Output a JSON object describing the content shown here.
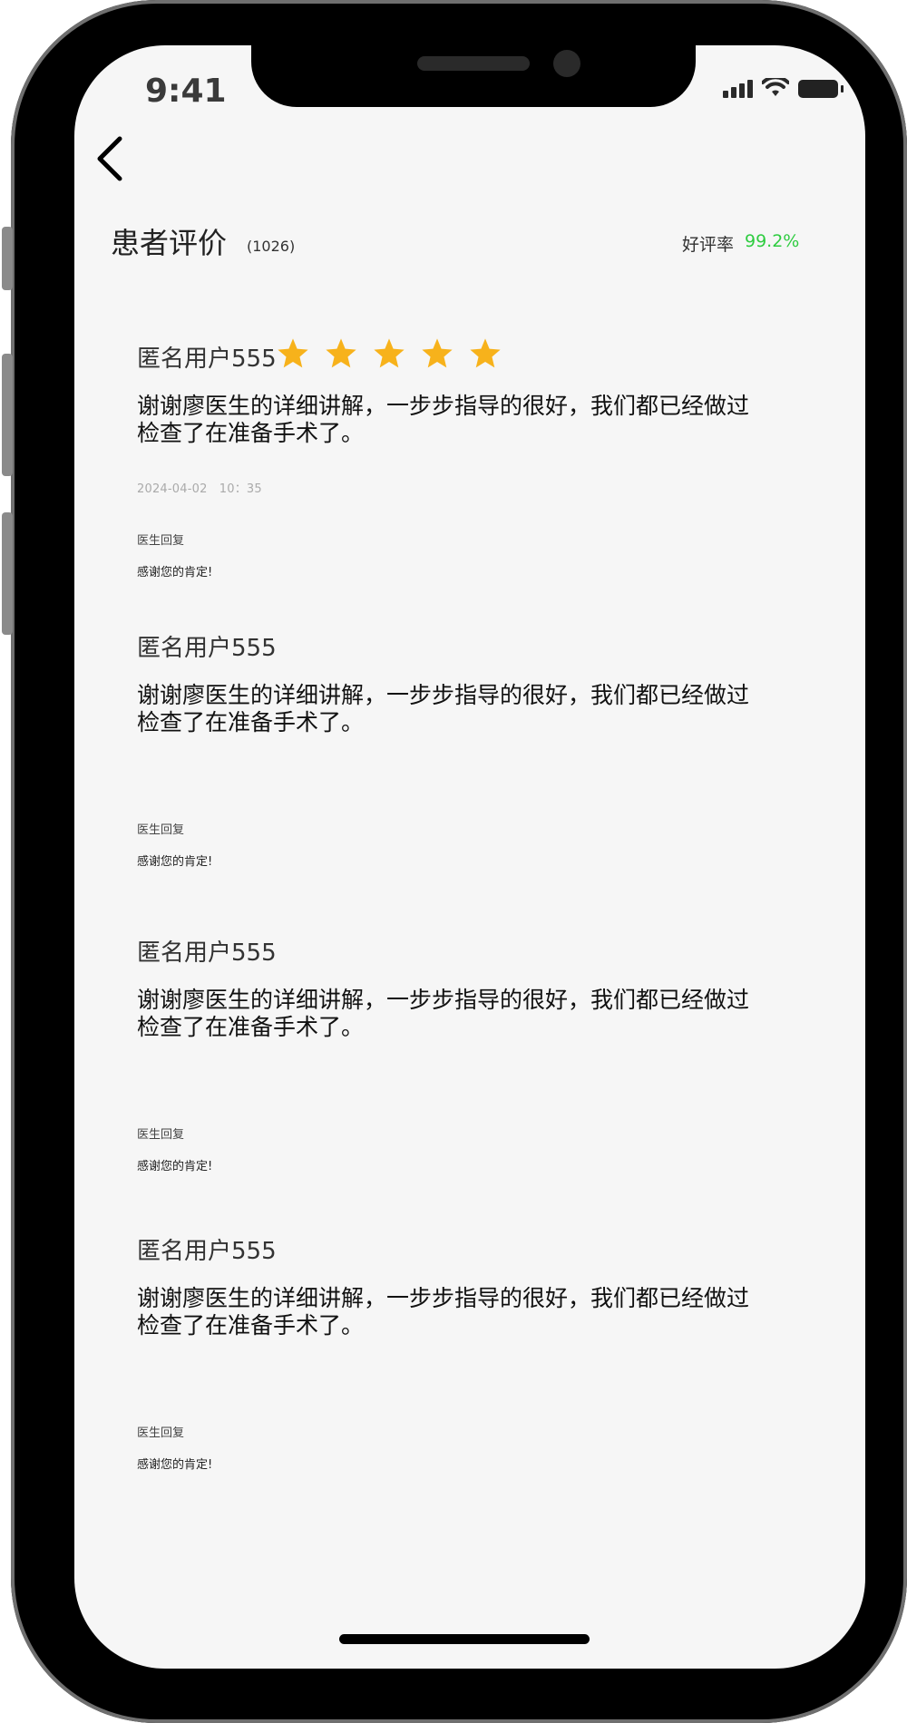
{
  "status_bar": {
    "time": "9:41"
  },
  "header": {
    "title": "患者评价",
    "count": "(1026)",
    "rating_label": "好评率",
    "rating_value": "99.2%",
    "rating_color": "#2ecc40"
  },
  "reviews": [
    {
      "user": "匿名用户555",
      "stars": 5,
      "text": "谢谢廖医生的详细讲解，一步步指导的很好，我们都已经做过检查了在准备手术了。",
      "datetime": "2024-04-02　10：35",
      "reply_label": "医生回复",
      "reply_text": "感谢您的肯定!"
    },
    {
      "user": "匿名用户555",
      "text": "谢谢廖医生的详细讲解，一步步指导的很好，我们都已经做过检查了在准备手术了。",
      "reply_label": "医生回复",
      "reply_text": "感谢您的肯定!"
    },
    {
      "user": "匿名用户555",
      "text": "谢谢廖医生的详细讲解，一步步指导的很好，我们都已经做过检查了在准备手术了。",
      "reply_label": "医生回复",
      "reply_text": "感谢您的肯定!"
    },
    {
      "user": "匿名用户555",
      "text": "谢谢廖医生的详细讲解，一步步指导的很好，我们都已经做过检查了在准备手术了。",
      "reply_label": "医生回复",
      "reply_text": "感谢您的肯定!"
    }
  ],
  "colors": {
    "star": "#f7b21b",
    "accent_green": "#2ecc40"
  },
  "icons": {
    "back": "chevron-left-icon",
    "star": "star-icon",
    "signal": "signal-icon",
    "wifi": "wifi-icon",
    "battery": "battery-icon"
  }
}
